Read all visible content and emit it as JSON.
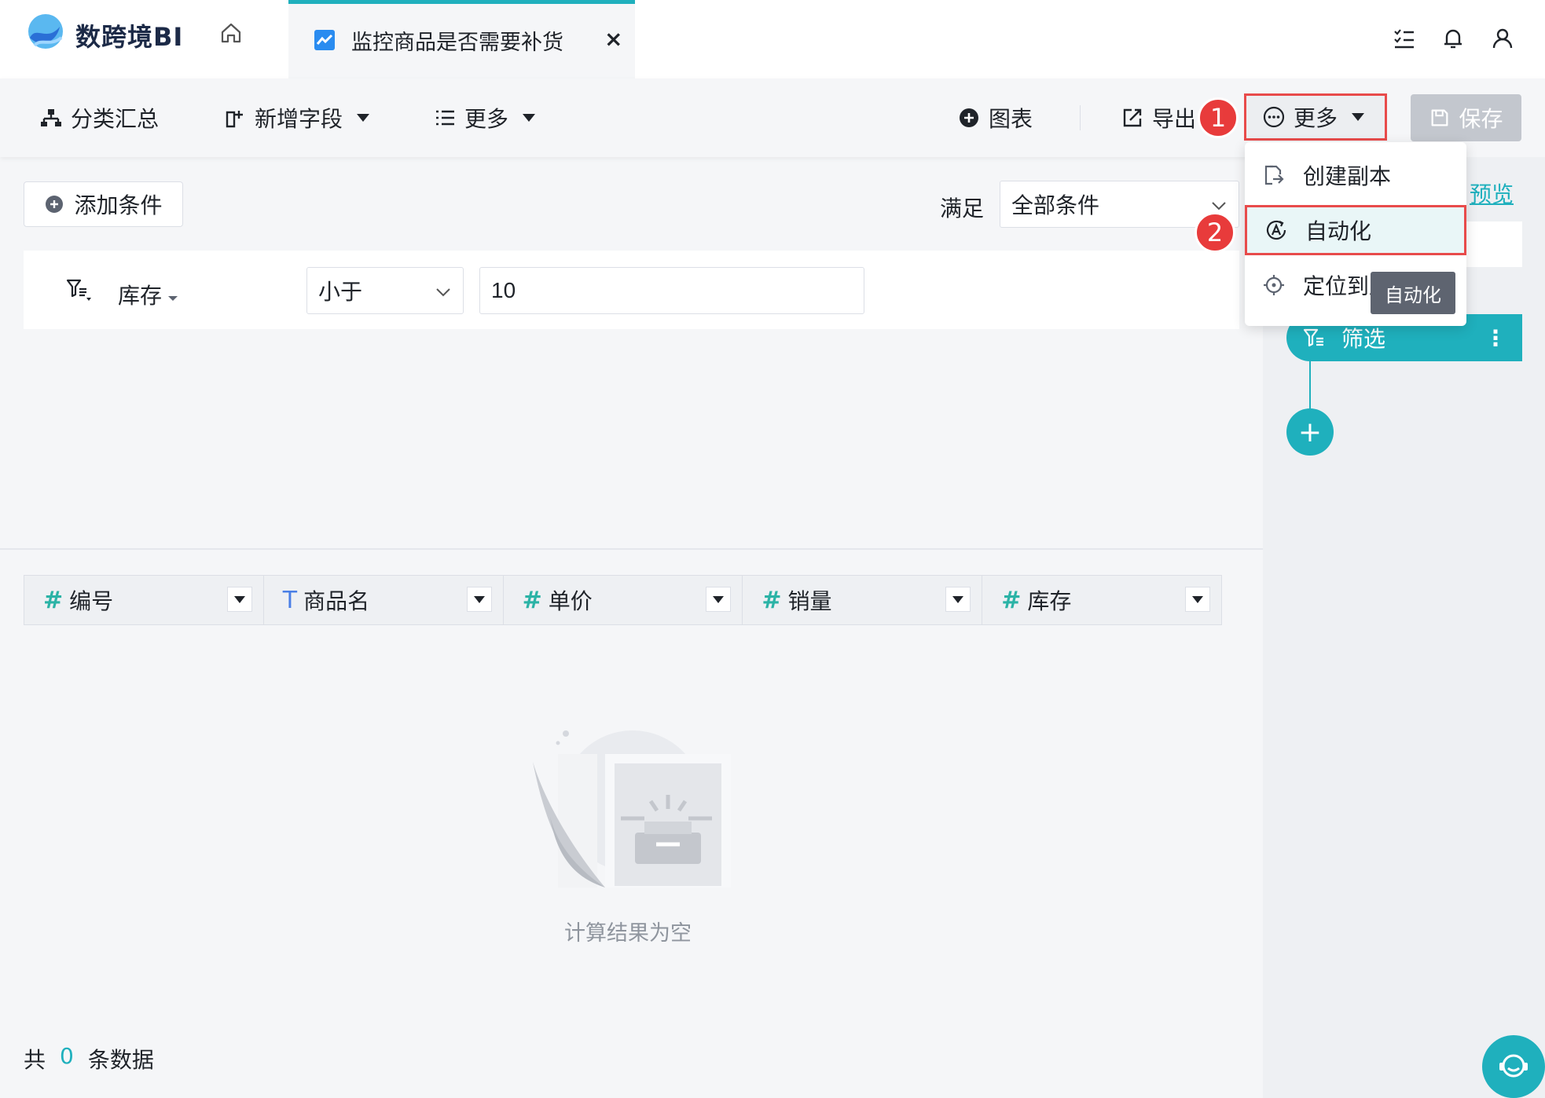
{
  "app": {
    "logo_text": "数跨境BI"
  },
  "tab": {
    "title": "监控商品是否需要补货",
    "close": "×"
  },
  "toolbar": {
    "group_summary": "分类汇总",
    "add_field": "新增字段",
    "more_left": "更多",
    "chart": "图表",
    "export": "导出",
    "more_right": "更多",
    "save": "保存"
  },
  "annotations": {
    "badge1": "1",
    "badge2": "2"
  },
  "filter": {
    "add_condition": "添加条件",
    "satisfy_label": "满足",
    "satisfy_value": "全部条件",
    "field": "库存",
    "operator": "小于",
    "value": "10"
  },
  "table": {
    "columns": [
      {
        "type": "#",
        "name": "编号"
      },
      {
        "type": "T",
        "name": "商品名"
      },
      {
        "type": "#",
        "name": "单价"
      },
      {
        "type": "#",
        "name": "销量"
      },
      {
        "type": "#",
        "name": "库存"
      }
    ],
    "empty_text": "计算结果为空",
    "footer_prefix": "共",
    "footer_count": "0",
    "footer_suffix": "条数据"
  },
  "right_panel": {
    "preview": "预览",
    "step_label": "筛选",
    "add": "+"
  },
  "menu": {
    "items": [
      {
        "label": "创建副本",
        "icon": "copy-icon"
      },
      {
        "label": "自动化",
        "icon": "automation-icon"
      },
      {
        "label": "定位到原",
        "icon": "locate-icon"
      }
    ],
    "tooltip": "自动化"
  },
  "colors": {
    "accent": "#1fb0bd",
    "highlight": "#e84b4b"
  }
}
